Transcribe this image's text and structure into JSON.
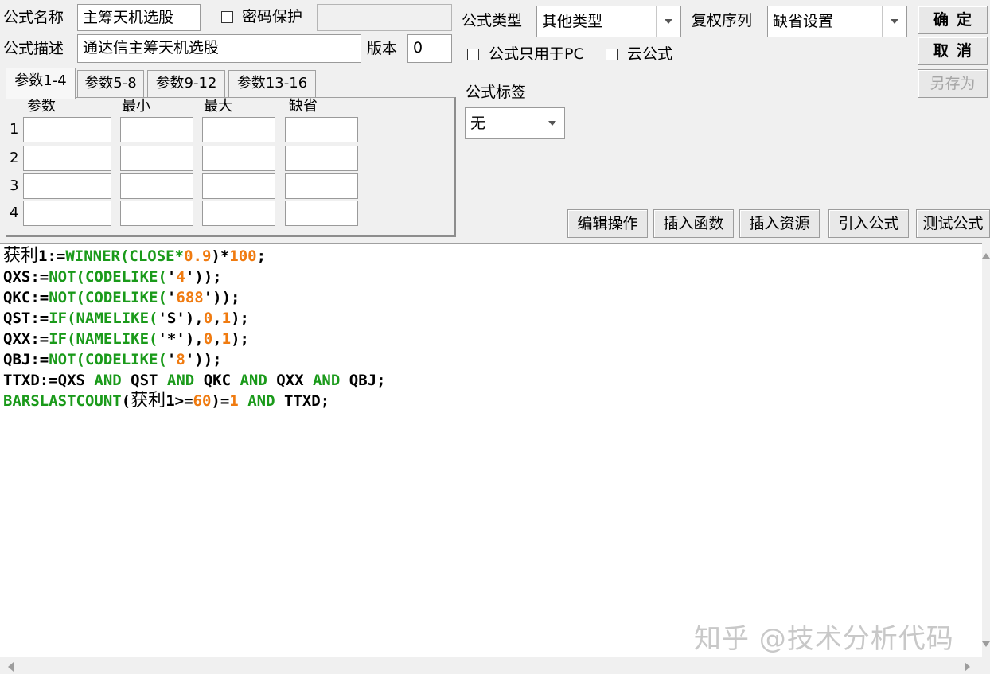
{
  "top": {
    "name_label": "公式名称",
    "name_value": "主筹天机选股",
    "password_label": "密码保护",
    "password_value": "",
    "desc_label": "公式描述",
    "desc_value": "通达信主筹天机选股",
    "version_label": "版本",
    "version_value": "0",
    "type_label": "公式类型",
    "type_value": "其他类型",
    "rights_label": "复权序列",
    "rights_value": "缺省设置",
    "pc_only_label": "公式只用于PC",
    "cloud_label": "云公式",
    "tag_label": "公式标签",
    "tag_value": "无"
  },
  "side_buttons": {
    "ok": "确定",
    "cancel": "取消",
    "save_as": "另存为"
  },
  "tabs": [
    "参数1-4",
    "参数5-8",
    "参数9-12",
    "参数13-16"
  ],
  "params": {
    "headers": [
      "参数",
      "最小",
      "最大",
      "缺省"
    ],
    "rows": [
      "1",
      "2",
      "3",
      "4"
    ]
  },
  "toolbar": [
    "编辑操作",
    "插入函数",
    "插入资源",
    "引入公式",
    "测试公式"
  ],
  "code_lines": [
    [
      {
        "t": "获利",
        "c": "cjk"
      },
      {
        "t": "1:=",
        "c": "k"
      },
      {
        "t": "WINNER(CLOSE*",
        "c": "g"
      },
      {
        "t": "0.9",
        "c": "o"
      },
      {
        "t": ")*",
        "c": "k"
      },
      {
        "t": "100",
        "c": "o"
      },
      {
        "t": ";",
        "c": "k"
      }
    ],
    [
      {
        "t": "QXS:=",
        "c": "k"
      },
      {
        "t": "NOT(CODELIKE(",
        "c": "g"
      },
      {
        "t": "'",
        "c": "k"
      },
      {
        "t": "4",
        "c": "o"
      },
      {
        "t": "'",
        "c": "k"
      },
      {
        "t": "));",
        "c": "k"
      }
    ],
    [
      {
        "t": "QKC:=",
        "c": "k"
      },
      {
        "t": "NOT(CODELIKE(",
        "c": "g"
      },
      {
        "t": "'",
        "c": "k"
      },
      {
        "t": "688",
        "c": "o"
      },
      {
        "t": "'",
        "c": "k"
      },
      {
        "t": "));",
        "c": "k"
      }
    ],
    [
      {
        "t": "QST:=",
        "c": "k"
      },
      {
        "t": "IF(NAMELIKE(",
        "c": "g"
      },
      {
        "t": "'S'",
        "c": "k"
      },
      {
        "t": "),",
        "c": "k"
      },
      {
        "t": "0",
        "c": "o"
      },
      {
        "t": ",",
        "c": "k"
      },
      {
        "t": "1",
        "c": "o"
      },
      {
        "t": ");",
        "c": "k"
      }
    ],
    [
      {
        "t": "QXX:=",
        "c": "k"
      },
      {
        "t": "IF(NAMELIKE(",
        "c": "g"
      },
      {
        "t": "'*'",
        "c": "k"
      },
      {
        "t": "),",
        "c": "k"
      },
      {
        "t": "0",
        "c": "o"
      },
      {
        "t": ",",
        "c": "k"
      },
      {
        "t": "1",
        "c": "o"
      },
      {
        "t": ");",
        "c": "k"
      }
    ],
    [
      {
        "t": "QBJ:=",
        "c": "k"
      },
      {
        "t": "NOT(CODELIKE(",
        "c": "g"
      },
      {
        "t": "'",
        "c": "k"
      },
      {
        "t": "8",
        "c": "o"
      },
      {
        "t": "'",
        "c": "k"
      },
      {
        "t": "));",
        "c": "k"
      }
    ],
    [
      {
        "t": "TTXD:=QXS ",
        "c": "k"
      },
      {
        "t": "AND",
        "c": "g"
      },
      {
        "t": " QST ",
        "c": "k"
      },
      {
        "t": "AND",
        "c": "g"
      },
      {
        "t": " QKC ",
        "c": "k"
      },
      {
        "t": "AND",
        "c": "g"
      },
      {
        "t": " QXX ",
        "c": "k"
      },
      {
        "t": "AND",
        "c": "g"
      },
      {
        "t": " QBJ;",
        "c": "k"
      }
    ],
    [
      {
        "t": "BARSLASTCOUNT",
        "c": "g"
      },
      {
        "t": "(",
        "c": "k"
      },
      {
        "t": "获利",
        "c": "cjk"
      },
      {
        "t": "1>=",
        "c": "k"
      },
      {
        "t": "60",
        "c": "o"
      },
      {
        "t": ")=",
        "c": "k"
      },
      {
        "t": "1",
        "c": "o"
      },
      {
        "t": " ",
        "c": "k"
      },
      {
        "t": "AND",
        "c": "g"
      },
      {
        "t": " TTXD;",
        "c": "k"
      }
    ]
  ],
  "colors": {
    "k": "#000000",
    "g": "#1a9a1a",
    "o": "#f07b10",
    "cjk": "#000000"
  },
  "watermark": "知乎 @技术分析代码"
}
